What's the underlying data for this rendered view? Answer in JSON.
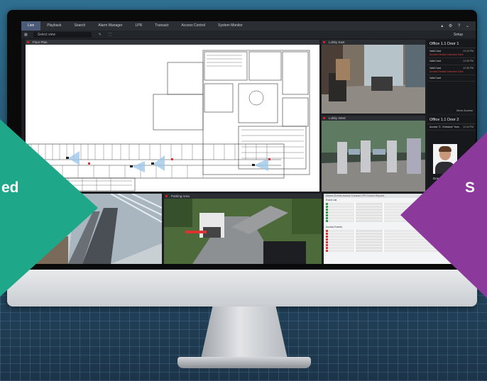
{
  "app": {
    "tabs": [
      "Live",
      "Playback",
      "Search",
      "Alarm Manager",
      "LPR",
      "Transact",
      "Access Control",
      "System Monitor"
    ],
    "active_tab": "Live",
    "toolbar": {
      "view_select": "Select view",
      "setup_label": "Setup"
    }
  },
  "panes": {
    "floor_plan": {
      "title": "Floor Plan"
    },
    "camera_1": {
      "title": "Lobby East"
    },
    "camera_2": {
      "title": "Lobby West"
    },
    "camera_4": {
      "title": "Parking Area"
    },
    "side_panel_1": {
      "header": "Office 1.1 Door 1",
      "events": [
        {
          "label": "Valid Card",
          "time": "12:34 PM",
          "detail": "Access Denied Unknown Card"
        },
        {
          "label": "Valid Card",
          "time": "12:35 PM",
          "detail": ""
        },
        {
          "label": "Valid Card",
          "time": "12:36 PM",
          "detail": "Access Denied Unknown Card"
        },
        {
          "label": "Valid Card",
          "time": "",
          "detail": ""
        }
      ],
      "more": "More Access"
    },
    "side_panel_2": {
      "header": "Office 1.1 Door 2",
      "request": "Access \"2 - Entrance\" from",
      "time": "12:34 PM",
      "person_name": "Doe, John"
    },
    "report": {
      "tabs": "Alarms  Events  Access  Transact  LPR  Control  Reports",
      "section1": "Event List",
      "section2": "Access Events"
    }
  },
  "overlays": {
    "left_color": "#1ea889",
    "right_color": "#8b3a9c",
    "left_label": "ed",
    "right_label": "S"
  }
}
